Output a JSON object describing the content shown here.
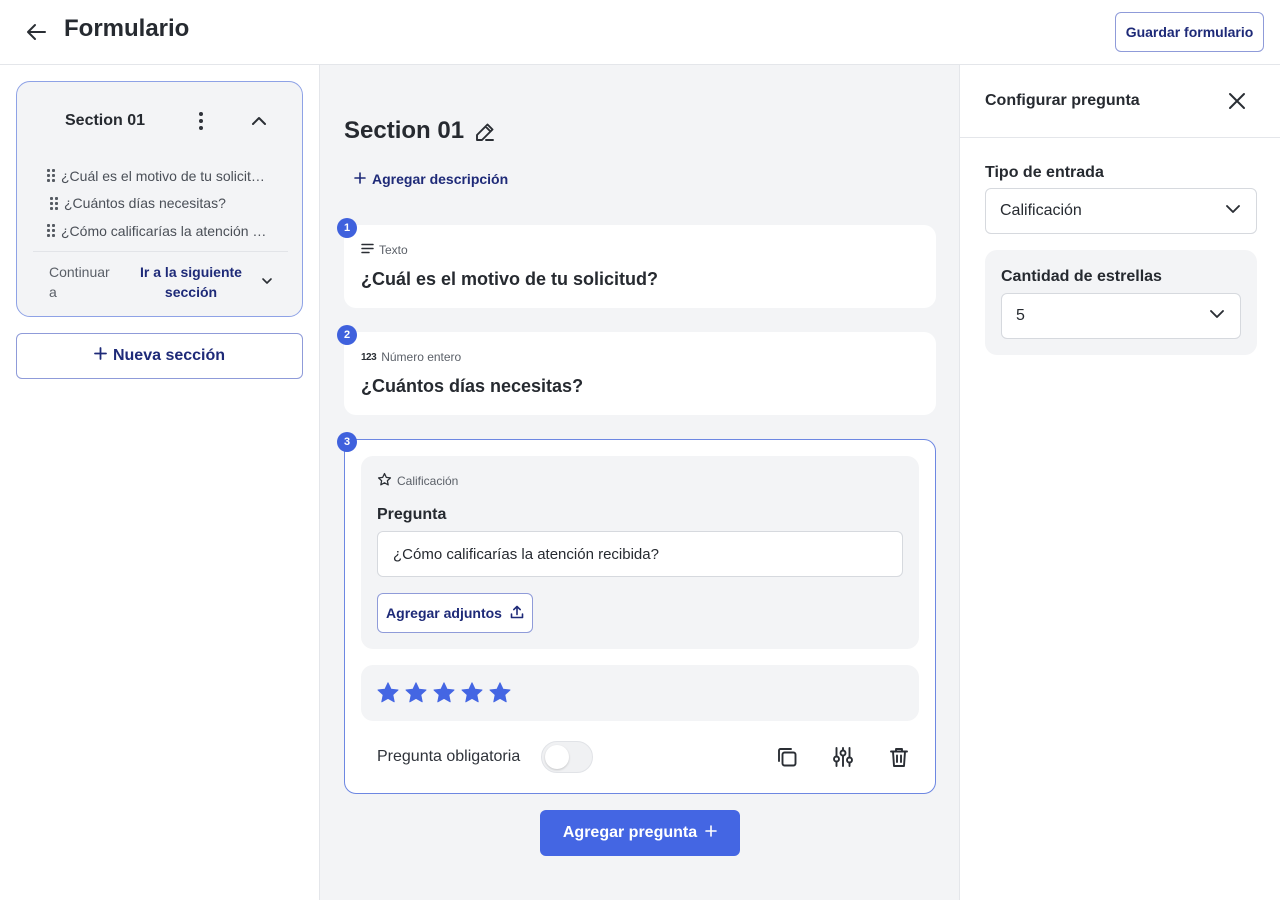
{
  "header": {
    "title": "Formulario",
    "save_label": "Guardar formulario"
  },
  "sidebar": {
    "section_title": "Section 01",
    "questions": [
      "¿Cuál es el motivo de tu solicitud?",
      "¿Cuántos días necesitas?",
      "¿Cómo calificarías la atención recibida?"
    ],
    "continue_label": "Continuar a",
    "continue_value": "Ir a la siguiente sección",
    "new_section_label": "Nueva sección"
  },
  "main": {
    "section_title": "Section 01",
    "add_description_label": "Agregar descripción",
    "questions": [
      {
        "number": "1",
        "type": "Texto",
        "title": "¿Cuál es el motivo de tu solicitud?"
      },
      {
        "number": "2",
        "type": "Número entero",
        "title": "¿Cuántos días necesitas?"
      },
      {
        "number": "3",
        "type": "Calificación",
        "label": "Pregunta",
        "value": "¿Cómo calificarías la atención recibida?",
        "attach_label": "Agregar adjuntos",
        "star_count": 5,
        "required_label": "Pregunta obligatoria",
        "required": false
      }
    ],
    "add_question_label": "Agregar pregunta"
  },
  "panel": {
    "title": "Configurar pregunta",
    "input_type_label": "Tipo de entrada",
    "input_type_value": "Calificación",
    "stars_label": "Cantidad de estrellas",
    "stars_value": "5"
  },
  "colors": {
    "accent": "#4466e3",
    "accent_dark": "#1e2a78",
    "badge": "#3f61dd",
    "star": "#4466e3"
  }
}
